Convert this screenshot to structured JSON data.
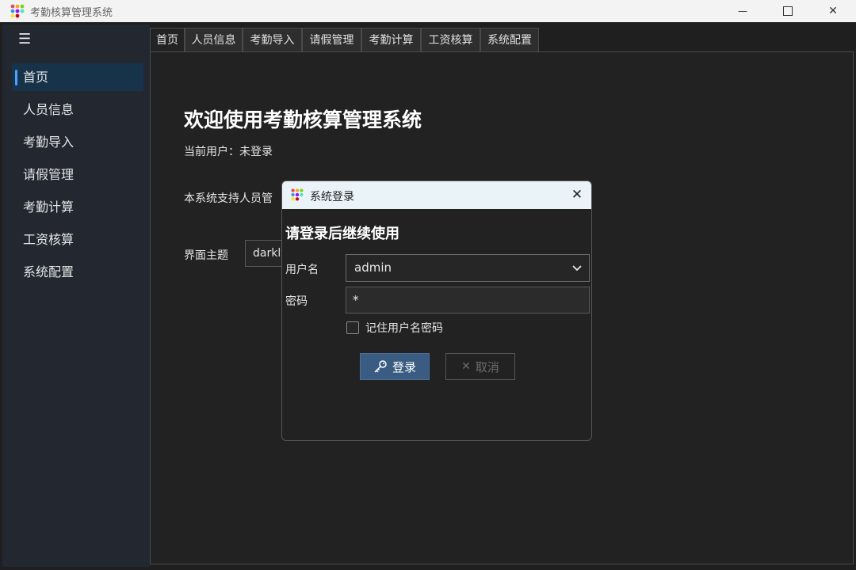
{
  "window": {
    "title": "考勤核算管理系统",
    "minimize_glyph": "—",
    "close_glyph": "✕"
  },
  "sidebar": {
    "menu_glyph": "☰",
    "items": [
      {
        "label": "首页",
        "active": true
      },
      {
        "label": "人员信息"
      },
      {
        "label": "考勤导入"
      },
      {
        "label": "请假管理"
      },
      {
        "label": "考勤计算"
      },
      {
        "label": "工资核算"
      },
      {
        "label": "系统配置"
      }
    ]
  },
  "tabs": [
    {
      "label": "首页",
      "active": true
    },
    {
      "label": "人员信息"
    },
    {
      "label": "考勤导入"
    },
    {
      "label": "请假管理"
    },
    {
      "label": "考勤计算"
    },
    {
      "label": "工资核算"
    },
    {
      "label": "系统配置"
    }
  ],
  "home": {
    "welcome": "欢迎使用考勤核算管理系统",
    "current_user": "当前用户：未登录",
    "support_text": "本系统支持人员管",
    "theme_label": "界面主题",
    "theme_value": "darkly"
  },
  "dialog": {
    "title": "系统登录",
    "close_glyph": "✕",
    "heading": "请登录后继续使用",
    "username_label": "用户名",
    "username_value": "admin",
    "password_label": "密码",
    "password_value": "*",
    "remember_label": "记住用户名密码",
    "login_label": "登录",
    "cancel_label": "取消",
    "cancel_glyph": "✕"
  },
  "colors": {
    "accent": "#4aa3ff",
    "primary_button": "#3a5c83",
    "background": "#222222"
  }
}
